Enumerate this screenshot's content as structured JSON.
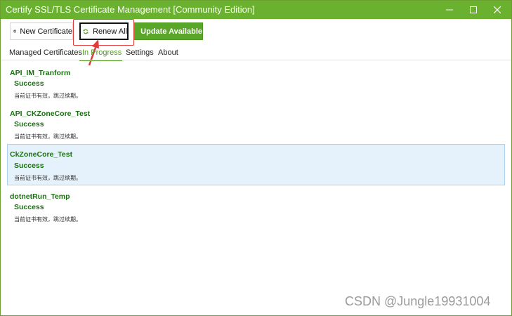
{
  "window": {
    "title": "Certify SSL/TLS Certificate Management [Community Edition]",
    "controls": {
      "minimize": "—",
      "maximize": "☐",
      "close": "✕"
    },
    "accent_color": "#6ab12f"
  },
  "toolbar": {
    "new_certificate": {
      "label": "New Certificate",
      "icon": "plus-circle-icon"
    },
    "renew_all": {
      "label": "Renew All",
      "icon": "refresh-icon"
    },
    "update_available": {
      "label": "Update Available",
      "icon": "download-icon"
    }
  },
  "tabs": [
    {
      "label": "Managed Certificates"
    },
    {
      "label": "In Progress",
      "active": true
    },
    {
      "label": "Settings"
    },
    {
      "label": "About"
    }
  ],
  "items": [
    {
      "name": "API_IM_Tranform",
      "status": "Success",
      "message": "当前证书有效，跳过续期。"
    },
    {
      "name": "API_CKZoneCore_Test",
      "status": "Success",
      "message": "当前证书有效，跳过续期。"
    },
    {
      "name": "CkZoneCore_Test",
      "status": "Success",
      "message": "当前证书有效，跳过续期。",
      "selected": true
    },
    {
      "name": "dotnetRun_Temp",
      "status": "Success",
      "message": "当前证书有效，跳过续期。"
    }
  ],
  "watermark": "CSDN @Jungle19931004",
  "colors": {
    "success_text": "#1b6f12",
    "highlight": "#e23b3b",
    "selected_row": "#e5f2fb"
  }
}
